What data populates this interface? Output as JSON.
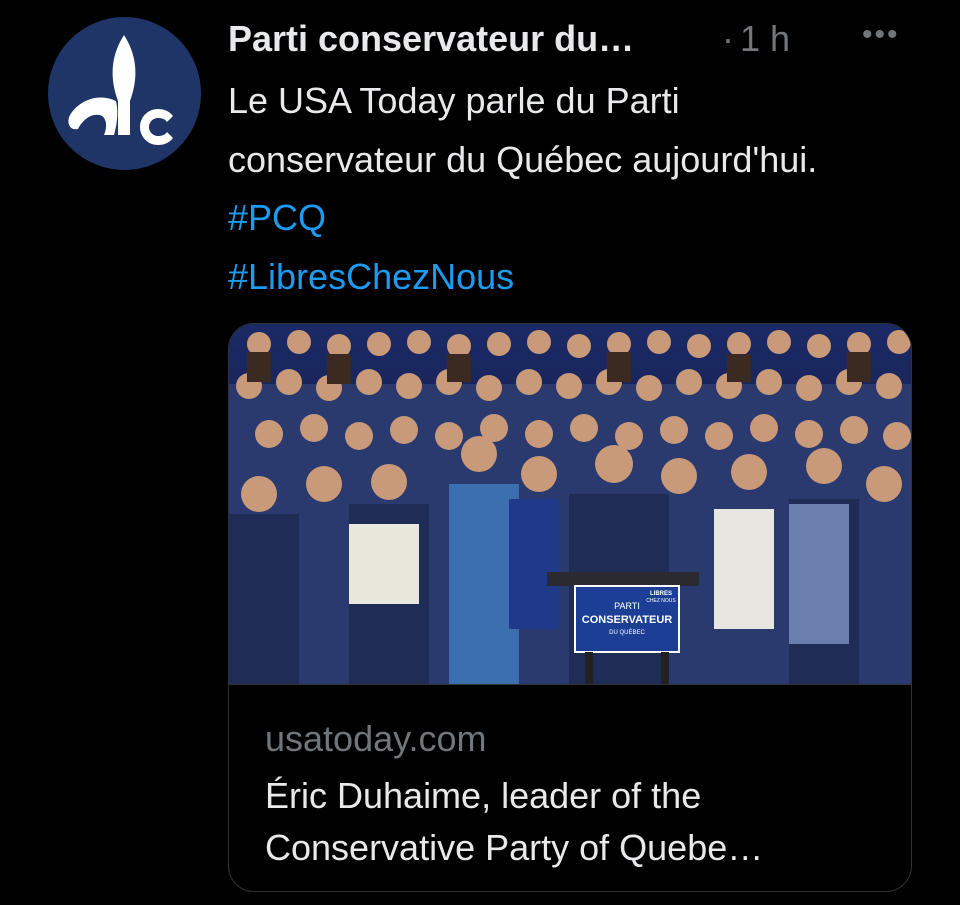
{
  "tweet": {
    "author_name": "Parti conservateur du…",
    "separator": "·",
    "time_ago": "1 h",
    "more_icon": "more-horizontal-icon",
    "avatar_icon": "fleur-de-lis-logo",
    "text_plain": "Le USA Today parle du Parti conservateur du Québec aujourd'hui.",
    "hashtags": [
      "#PCQ",
      "#LibresChezNous"
    ],
    "link_color": "#1d9bf0",
    "avatar_bg": "#1f3467"
  },
  "card": {
    "domain": "usatoday.com",
    "title": "Éric Duhaime, leader of the Conservative Party of Quebe…",
    "podium_sign": {
      "line1": "PARTI",
      "line2": "CONSERVATEUR",
      "line3": "DU QUÉBEC",
      "corner_line1": "LIBRES",
      "corner_line2": "CHEZ NOUS"
    }
  }
}
